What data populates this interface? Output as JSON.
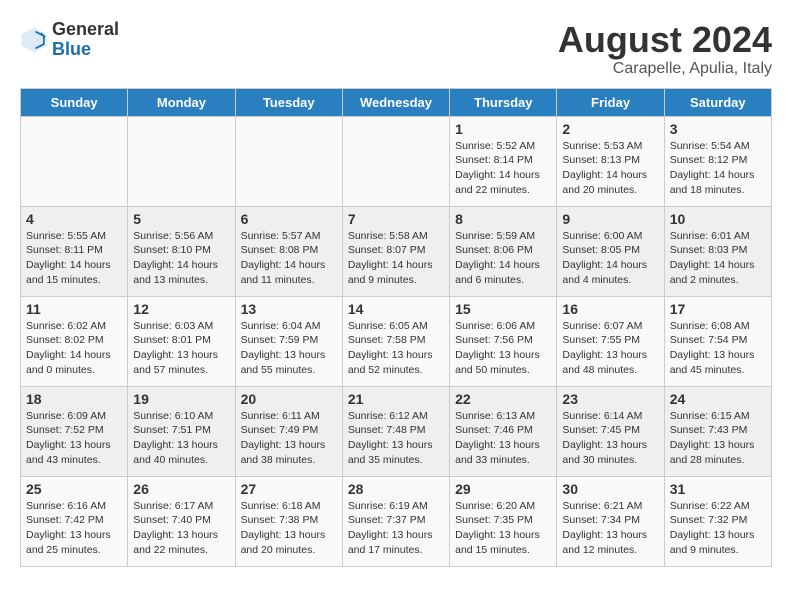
{
  "header": {
    "logo_general": "General",
    "logo_blue": "Blue",
    "month_year": "August 2024",
    "location": "Carapelle, Apulia, Italy"
  },
  "days_of_week": [
    "Sunday",
    "Monday",
    "Tuesday",
    "Wednesday",
    "Thursday",
    "Friday",
    "Saturday"
  ],
  "weeks": [
    [
      {
        "date": "",
        "info": ""
      },
      {
        "date": "",
        "info": ""
      },
      {
        "date": "",
        "info": ""
      },
      {
        "date": "",
        "info": ""
      },
      {
        "date": "1",
        "info": "Sunrise: 5:52 AM\nSunset: 8:14 PM\nDaylight: 14 hours and 22 minutes."
      },
      {
        "date": "2",
        "info": "Sunrise: 5:53 AM\nSunset: 8:13 PM\nDaylight: 14 hours and 20 minutes."
      },
      {
        "date": "3",
        "info": "Sunrise: 5:54 AM\nSunset: 8:12 PM\nDaylight: 14 hours and 18 minutes."
      }
    ],
    [
      {
        "date": "4",
        "info": "Sunrise: 5:55 AM\nSunset: 8:11 PM\nDaylight: 14 hours and 15 minutes."
      },
      {
        "date": "5",
        "info": "Sunrise: 5:56 AM\nSunset: 8:10 PM\nDaylight: 14 hours and 13 minutes."
      },
      {
        "date": "6",
        "info": "Sunrise: 5:57 AM\nSunset: 8:08 PM\nDaylight: 14 hours and 11 minutes."
      },
      {
        "date": "7",
        "info": "Sunrise: 5:58 AM\nSunset: 8:07 PM\nDaylight: 14 hours and 9 minutes."
      },
      {
        "date": "8",
        "info": "Sunrise: 5:59 AM\nSunset: 8:06 PM\nDaylight: 14 hours and 6 minutes."
      },
      {
        "date": "9",
        "info": "Sunrise: 6:00 AM\nSunset: 8:05 PM\nDaylight: 14 hours and 4 minutes."
      },
      {
        "date": "10",
        "info": "Sunrise: 6:01 AM\nSunset: 8:03 PM\nDaylight: 14 hours and 2 minutes."
      }
    ],
    [
      {
        "date": "11",
        "info": "Sunrise: 6:02 AM\nSunset: 8:02 PM\nDaylight: 14 hours and 0 minutes."
      },
      {
        "date": "12",
        "info": "Sunrise: 6:03 AM\nSunset: 8:01 PM\nDaylight: 13 hours and 57 minutes."
      },
      {
        "date": "13",
        "info": "Sunrise: 6:04 AM\nSunset: 7:59 PM\nDaylight: 13 hours and 55 minutes."
      },
      {
        "date": "14",
        "info": "Sunrise: 6:05 AM\nSunset: 7:58 PM\nDaylight: 13 hours and 52 minutes."
      },
      {
        "date": "15",
        "info": "Sunrise: 6:06 AM\nSunset: 7:56 PM\nDaylight: 13 hours and 50 minutes."
      },
      {
        "date": "16",
        "info": "Sunrise: 6:07 AM\nSunset: 7:55 PM\nDaylight: 13 hours and 48 minutes."
      },
      {
        "date": "17",
        "info": "Sunrise: 6:08 AM\nSunset: 7:54 PM\nDaylight: 13 hours and 45 minutes."
      }
    ],
    [
      {
        "date": "18",
        "info": "Sunrise: 6:09 AM\nSunset: 7:52 PM\nDaylight: 13 hours and 43 minutes."
      },
      {
        "date": "19",
        "info": "Sunrise: 6:10 AM\nSunset: 7:51 PM\nDaylight: 13 hours and 40 minutes."
      },
      {
        "date": "20",
        "info": "Sunrise: 6:11 AM\nSunset: 7:49 PM\nDaylight: 13 hours and 38 minutes."
      },
      {
        "date": "21",
        "info": "Sunrise: 6:12 AM\nSunset: 7:48 PM\nDaylight: 13 hours and 35 minutes."
      },
      {
        "date": "22",
        "info": "Sunrise: 6:13 AM\nSunset: 7:46 PM\nDaylight: 13 hours and 33 minutes."
      },
      {
        "date": "23",
        "info": "Sunrise: 6:14 AM\nSunset: 7:45 PM\nDaylight: 13 hours and 30 minutes."
      },
      {
        "date": "24",
        "info": "Sunrise: 6:15 AM\nSunset: 7:43 PM\nDaylight: 13 hours and 28 minutes."
      }
    ],
    [
      {
        "date": "25",
        "info": "Sunrise: 6:16 AM\nSunset: 7:42 PM\nDaylight: 13 hours and 25 minutes."
      },
      {
        "date": "26",
        "info": "Sunrise: 6:17 AM\nSunset: 7:40 PM\nDaylight: 13 hours and 22 minutes."
      },
      {
        "date": "27",
        "info": "Sunrise: 6:18 AM\nSunset: 7:38 PM\nDaylight: 13 hours and 20 minutes."
      },
      {
        "date": "28",
        "info": "Sunrise: 6:19 AM\nSunset: 7:37 PM\nDaylight: 13 hours and 17 minutes."
      },
      {
        "date": "29",
        "info": "Sunrise: 6:20 AM\nSunset: 7:35 PM\nDaylight: 13 hours and 15 minutes."
      },
      {
        "date": "30",
        "info": "Sunrise: 6:21 AM\nSunset: 7:34 PM\nDaylight: 13 hours and 12 minutes."
      },
      {
        "date": "31",
        "info": "Sunrise: 6:22 AM\nSunset: 7:32 PM\nDaylight: 13 hours and 9 minutes."
      }
    ]
  ]
}
